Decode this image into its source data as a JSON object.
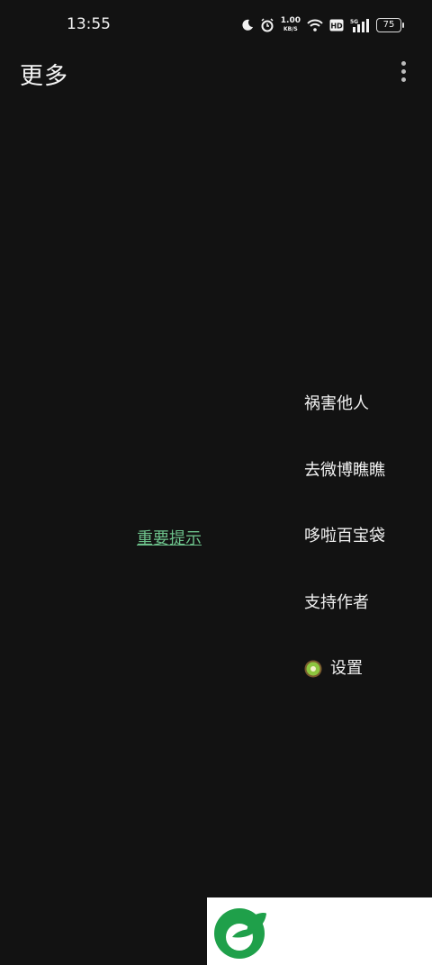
{
  "status_bar": {
    "time": "13:55",
    "net_speed_value": "1.00",
    "net_speed_unit": "KB/S",
    "hd_label": "HD",
    "signal_label": "5G",
    "battery": "75"
  },
  "app_bar": {
    "title": "更多"
  },
  "notice_link": "重要提示",
  "menu": {
    "items": [
      {
        "label": "祸害他人"
      },
      {
        "label": "去微博瞧瞧"
      },
      {
        "label": "哆啦百宝袋"
      },
      {
        "label": "支持作者"
      },
      {
        "label": "设置",
        "icon": "kiwi-icon"
      }
    ]
  },
  "colors": {
    "background": "#121212",
    "link": "#6cc08a",
    "watermark_logo": "#1fa04a"
  }
}
